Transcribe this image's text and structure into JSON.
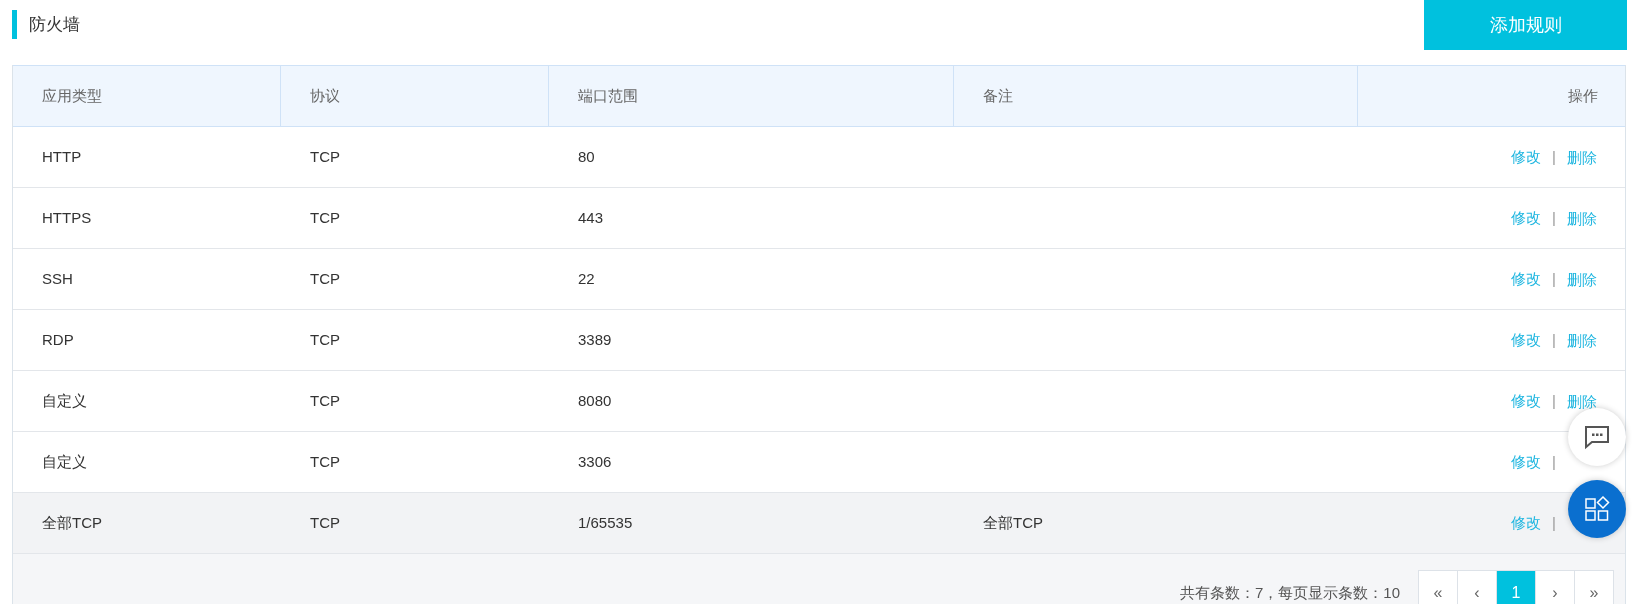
{
  "title": "防火墙",
  "add_button": "添加规则",
  "table": {
    "columns": [
      "应用类型",
      "协议",
      "端口范围",
      "备注",
      "操作"
    ],
    "rows": [
      {
        "type": "HTTP",
        "protocol": "TCP",
        "ports": "80",
        "note": "",
        "edit": "修改",
        "separator": "|",
        "delete": "删除",
        "highlighted": false
      },
      {
        "type": "HTTPS",
        "protocol": "TCP",
        "ports": "443",
        "note": "",
        "edit": "修改",
        "separator": "|",
        "delete": "删除",
        "highlighted": false
      },
      {
        "type": "SSH",
        "protocol": "TCP",
        "ports": "22",
        "note": "",
        "edit": "修改",
        "separator": "|",
        "delete": "删除",
        "highlighted": false
      },
      {
        "type": "RDP",
        "protocol": "TCP",
        "ports": "3389",
        "note": "",
        "edit": "修改",
        "separator": "|",
        "delete": "删除",
        "highlighted": false
      },
      {
        "type": "自定义",
        "protocol": "TCP",
        "ports": "8080",
        "note": "",
        "edit": "修改",
        "separator": "|",
        "delete": "删除",
        "highlighted": false
      },
      {
        "type": "自定义",
        "protocol": "TCP",
        "ports": "3306",
        "note": "",
        "edit": "修改",
        "separator": "|",
        "highlighted": false
      },
      {
        "type": "全部TCP",
        "protocol": "TCP",
        "ports": "1/65535",
        "note": "全部TCP",
        "edit": "修改",
        "separator": "|",
        "highlighted": true
      }
    ]
  },
  "pagination": {
    "summary": "共有条数：7，每页显示条数：10",
    "buttons": [
      {
        "label": "«",
        "selected": false
      },
      {
        "label": "‹",
        "selected": false
      },
      {
        "label": "1",
        "selected": true
      },
      {
        "label": "›",
        "selected": false
      },
      {
        "label": "»",
        "selected": false
      }
    ]
  }
}
